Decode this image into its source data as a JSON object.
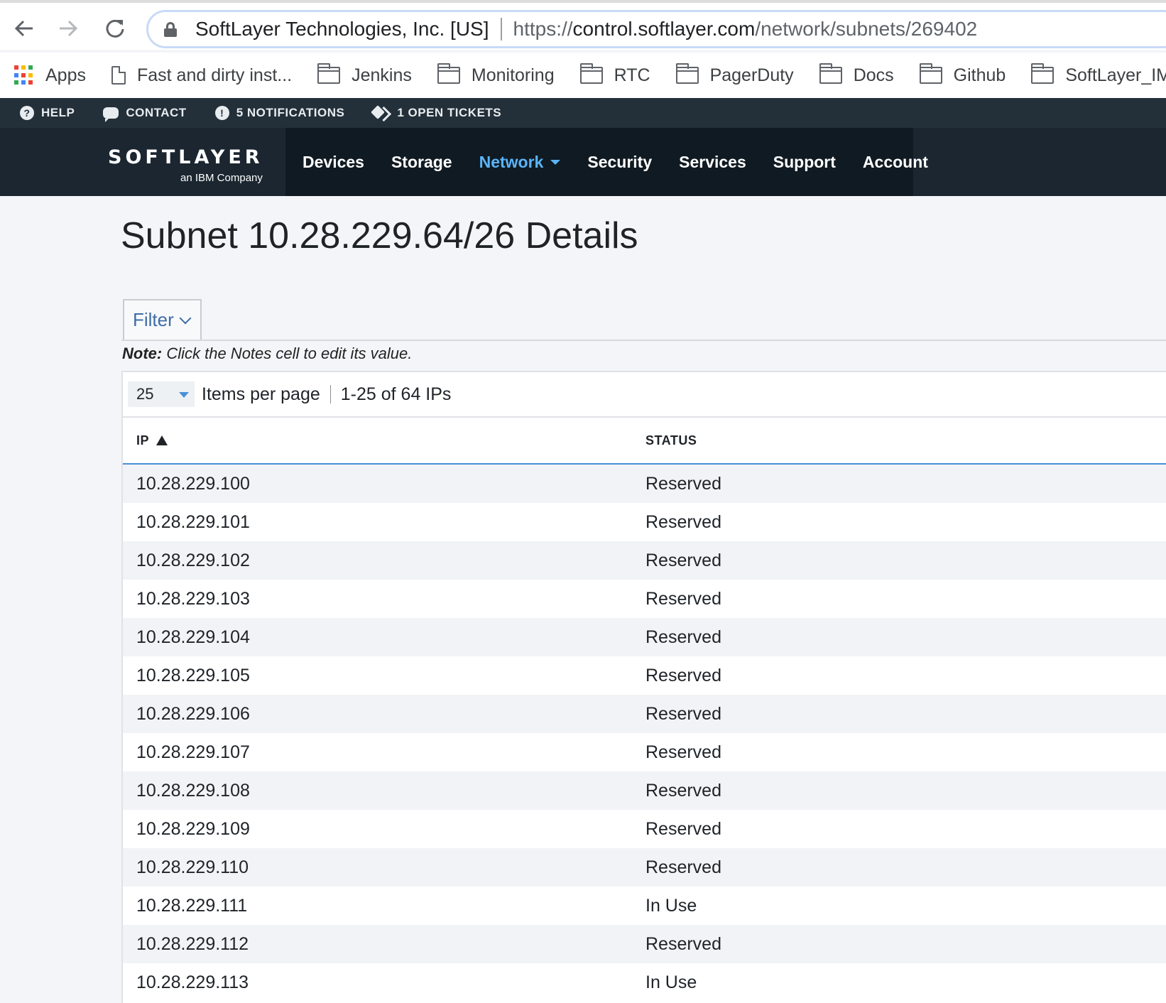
{
  "browser": {
    "site_identity": "SoftLayer Technologies, Inc. [US]",
    "url_scheme": "https://",
    "url_host": "control.softlayer.com",
    "url_path": "/network/subnets/269402",
    "bookmarks": [
      {
        "label": "Apps",
        "icon": "apps-grid-icon"
      },
      {
        "label": "Fast and dirty inst...",
        "icon": "page-icon"
      },
      {
        "label": "Jenkins",
        "icon": "folder-icon"
      },
      {
        "label": "Monitoring",
        "icon": "folder-icon"
      },
      {
        "label": "RTC",
        "icon": "folder-icon"
      },
      {
        "label": "PagerDuty",
        "icon": "folder-icon"
      },
      {
        "label": "Docs",
        "icon": "folder-icon"
      },
      {
        "label": "Github",
        "icon": "folder-icon"
      },
      {
        "label": "SoftLayer_IM",
        "icon": "folder-icon"
      }
    ]
  },
  "utility_bar": {
    "help": "HELP",
    "contact": "CONTACT",
    "notifications": "5 NOTIFICATIONS",
    "tickets": "1 OPEN TICKETS"
  },
  "brand": {
    "logo": "SOFTLAYER",
    "tagline": "an IBM Company"
  },
  "nav": {
    "items": [
      "Devices",
      "Storage",
      "Network",
      "Security",
      "Services",
      "Support",
      "Account"
    ],
    "active": "Network"
  },
  "page": {
    "title": "Subnet 10.28.229.64/26 Details",
    "filter_label": "Filter",
    "note_label": "Note:",
    "note_text": " Click the Notes cell to edit its value."
  },
  "pager": {
    "per_page_value": "25",
    "per_page_label": "Items per page",
    "range": "1-25 of 64 IPs"
  },
  "table": {
    "columns": [
      "IP",
      "STATUS"
    ],
    "rows": [
      {
        "ip": "10.28.229.100",
        "status": "Reserved"
      },
      {
        "ip": "10.28.229.101",
        "status": "Reserved"
      },
      {
        "ip": "10.28.229.102",
        "status": "Reserved"
      },
      {
        "ip": "10.28.229.103",
        "status": "Reserved"
      },
      {
        "ip": "10.28.229.104",
        "status": "Reserved"
      },
      {
        "ip": "10.28.229.105",
        "status": "Reserved"
      },
      {
        "ip": "10.28.229.106",
        "status": "Reserved"
      },
      {
        "ip": "10.28.229.107",
        "status": "Reserved"
      },
      {
        "ip": "10.28.229.108",
        "status": "Reserved"
      },
      {
        "ip": "10.28.229.109",
        "status": "Reserved"
      },
      {
        "ip": "10.28.229.110",
        "status": "Reserved"
      },
      {
        "ip": "10.28.229.111",
        "status": "In Use"
      },
      {
        "ip": "10.28.229.112",
        "status": "Reserved"
      },
      {
        "ip": "10.28.229.113",
        "status": "In Use"
      }
    ]
  },
  "colors": {
    "accent": "#4a90d9",
    "nav_active": "#5ab4f8",
    "topbar": "#232f39",
    "navbar": "#101a22"
  }
}
